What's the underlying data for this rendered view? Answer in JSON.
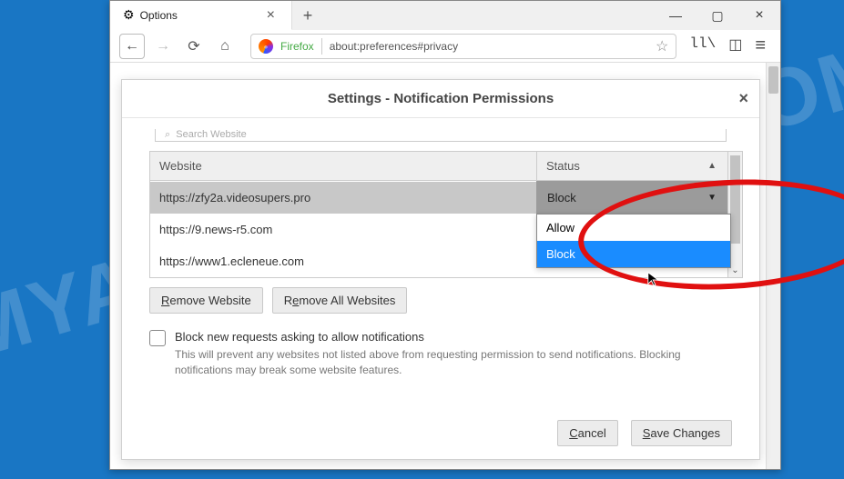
{
  "browser": {
    "tab_title": "Options",
    "firefox_label": "Firefox",
    "url": "about:preferences#privacy"
  },
  "dialog": {
    "title": "Settings - Notification Permissions",
    "search_placeholder": "Search Website",
    "columns": {
      "website": "Website",
      "status": "Status"
    },
    "rows": [
      {
        "site": "https://zfy2a.videosupers.pro",
        "status": "Block"
      },
      {
        "site": "https://9.news-r5.com",
        "status": ""
      },
      {
        "site": "https://www1.ecleneue.com",
        "status": ""
      }
    ],
    "options": {
      "allow": "Allow",
      "block": "Block"
    },
    "remove_website": "Remove Website",
    "remove_all": "Remove All Websites",
    "block_new_label": "Block new requests asking to allow notifications",
    "block_new_desc": "This will prevent any websites not listed above from requesting permission to send notifications. Blocking notifications may break some website features.",
    "cancel": "Cancel",
    "save": "Save Changes"
  }
}
